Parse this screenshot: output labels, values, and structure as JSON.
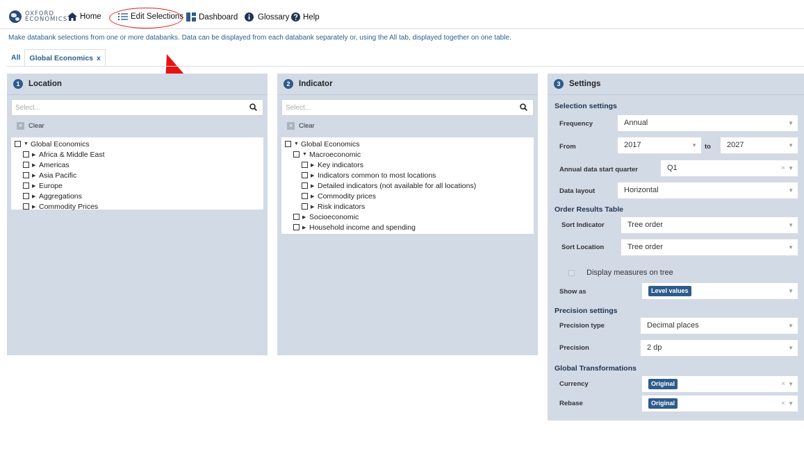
{
  "nav": {
    "logo_line1": "OXFORD",
    "logo_line2": "ECONOMICS",
    "home": "Home",
    "edit_selections": "Edit Selections",
    "dashboard": "Dashboard",
    "glossary": "Glossary",
    "help": "Help"
  },
  "intro_text": "Make databank selections from one or more databanks. Data can be displayed from each databank separately or, using the All tab, displayed together on one table.",
  "tabs": {
    "all": "All",
    "active": "Global Economics",
    "close": "x"
  },
  "location": {
    "step": "1",
    "title": "Location",
    "search_placeholder": "Select...",
    "clear": "Clear",
    "tree": [
      "Global Economics",
      "Africa & Middle East",
      "Americas",
      "Asia Pacific",
      "Europe",
      "Aggregations",
      "Commodity Prices"
    ]
  },
  "indicator": {
    "step": "2",
    "title": "Indicator",
    "search_placeholder": "Select...",
    "clear": "Clear",
    "tree": [
      "Global Economics",
      "Macroeconomic",
      "Key indicators",
      "Indicators common to most locations",
      "Detailed indicators (not available for all locations)",
      "Commodity prices",
      "Risk indicators",
      "Socioeconomic",
      "Household income and spending"
    ]
  },
  "settings": {
    "step": "3",
    "title": "Settings",
    "selection_settings": "Selection settings",
    "frequency_label": "Frequency",
    "frequency_value": "Annual",
    "from_label": "From",
    "from_value": "2017",
    "to_label": "to",
    "to_value": "2027",
    "start_quarter_label": "Annual data start quarter",
    "start_quarter_value": "Q1",
    "data_layout_label": "Data layout",
    "data_layout_value": "Horizontal",
    "order_results": "Order Results Table",
    "sort_indicator_label": "Sort Indicator",
    "sort_indicator_value": "Tree order",
    "sort_location_label": "Sort Location",
    "sort_location_value": "Tree order",
    "display_measures": "Display measures on tree",
    "show_as_label": "Show as",
    "show_as_value": "Level values",
    "precision_settings": "Precision settings",
    "precision_type_label": "Precision type",
    "precision_type_value": "Decimal places",
    "precision_label": "Precision",
    "precision_value": "2 dp",
    "global_transformations": "Global Transformations",
    "currency_label": "Currency",
    "currency_value": "Original",
    "rebase_label": "Rebase",
    "rebase_value": "Original"
  },
  "icons": {
    "caret": "▼",
    "clear_x": "×",
    "tri_down": "▼",
    "tri_right": "▶"
  },
  "colors": {
    "accent": "#2d5b8d",
    "panel": "#d2dae6",
    "highlight": "#e0221e"
  }
}
